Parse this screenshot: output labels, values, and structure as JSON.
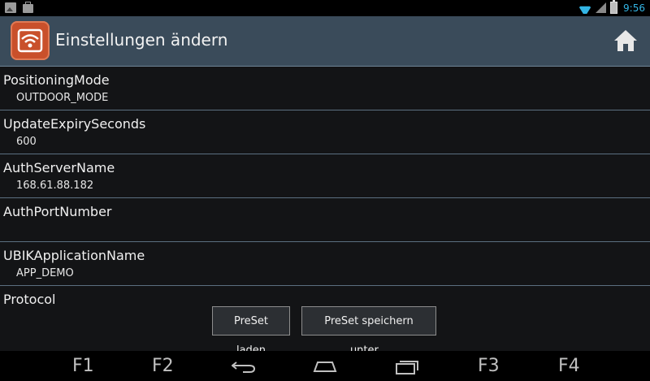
{
  "status_bar": {
    "left_icons": [
      "image-icon",
      "shopping-bag-icon"
    ],
    "right_icons": [
      "wifi-icon",
      "signal-icon",
      "battery-icon"
    ],
    "time": "9:56"
  },
  "action_bar": {
    "title": "Einstellungen ändern",
    "app_icon": "wifi-app-icon",
    "home_icon": "home-icon"
  },
  "settings": [
    {
      "label": "PositioningMode",
      "value": "OUTDOOR_MODE"
    },
    {
      "label": "UpdateExpirySeconds",
      "value": "600"
    },
    {
      "label": "AuthServerName",
      "value": "168.61.88.182"
    },
    {
      "label": "AuthPortNumber",
      "value": ""
    },
    {
      "label": "UBIKApplicationName",
      "value": "APP_DEMO"
    },
    {
      "label": "Protocol",
      "value": ""
    }
  ],
  "buttons": {
    "load_preset": "PreSet laden",
    "save_preset": "PreSet speichern unter..."
  },
  "nav_bar": {
    "f1": "F1",
    "f2": "F2",
    "f3": "F3",
    "f4": "F4",
    "icons": [
      "back-icon",
      "home-nav-icon",
      "recent-apps-icon"
    ]
  },
  "colors": {
    "action_bar_bg": "#3a4b5a",
    "app_icon_bg": "#c9502b",
    "list_bg": "#131416",
    "divider": "#5b6f80",
    "accent": "#33b5e5"
  }
}
